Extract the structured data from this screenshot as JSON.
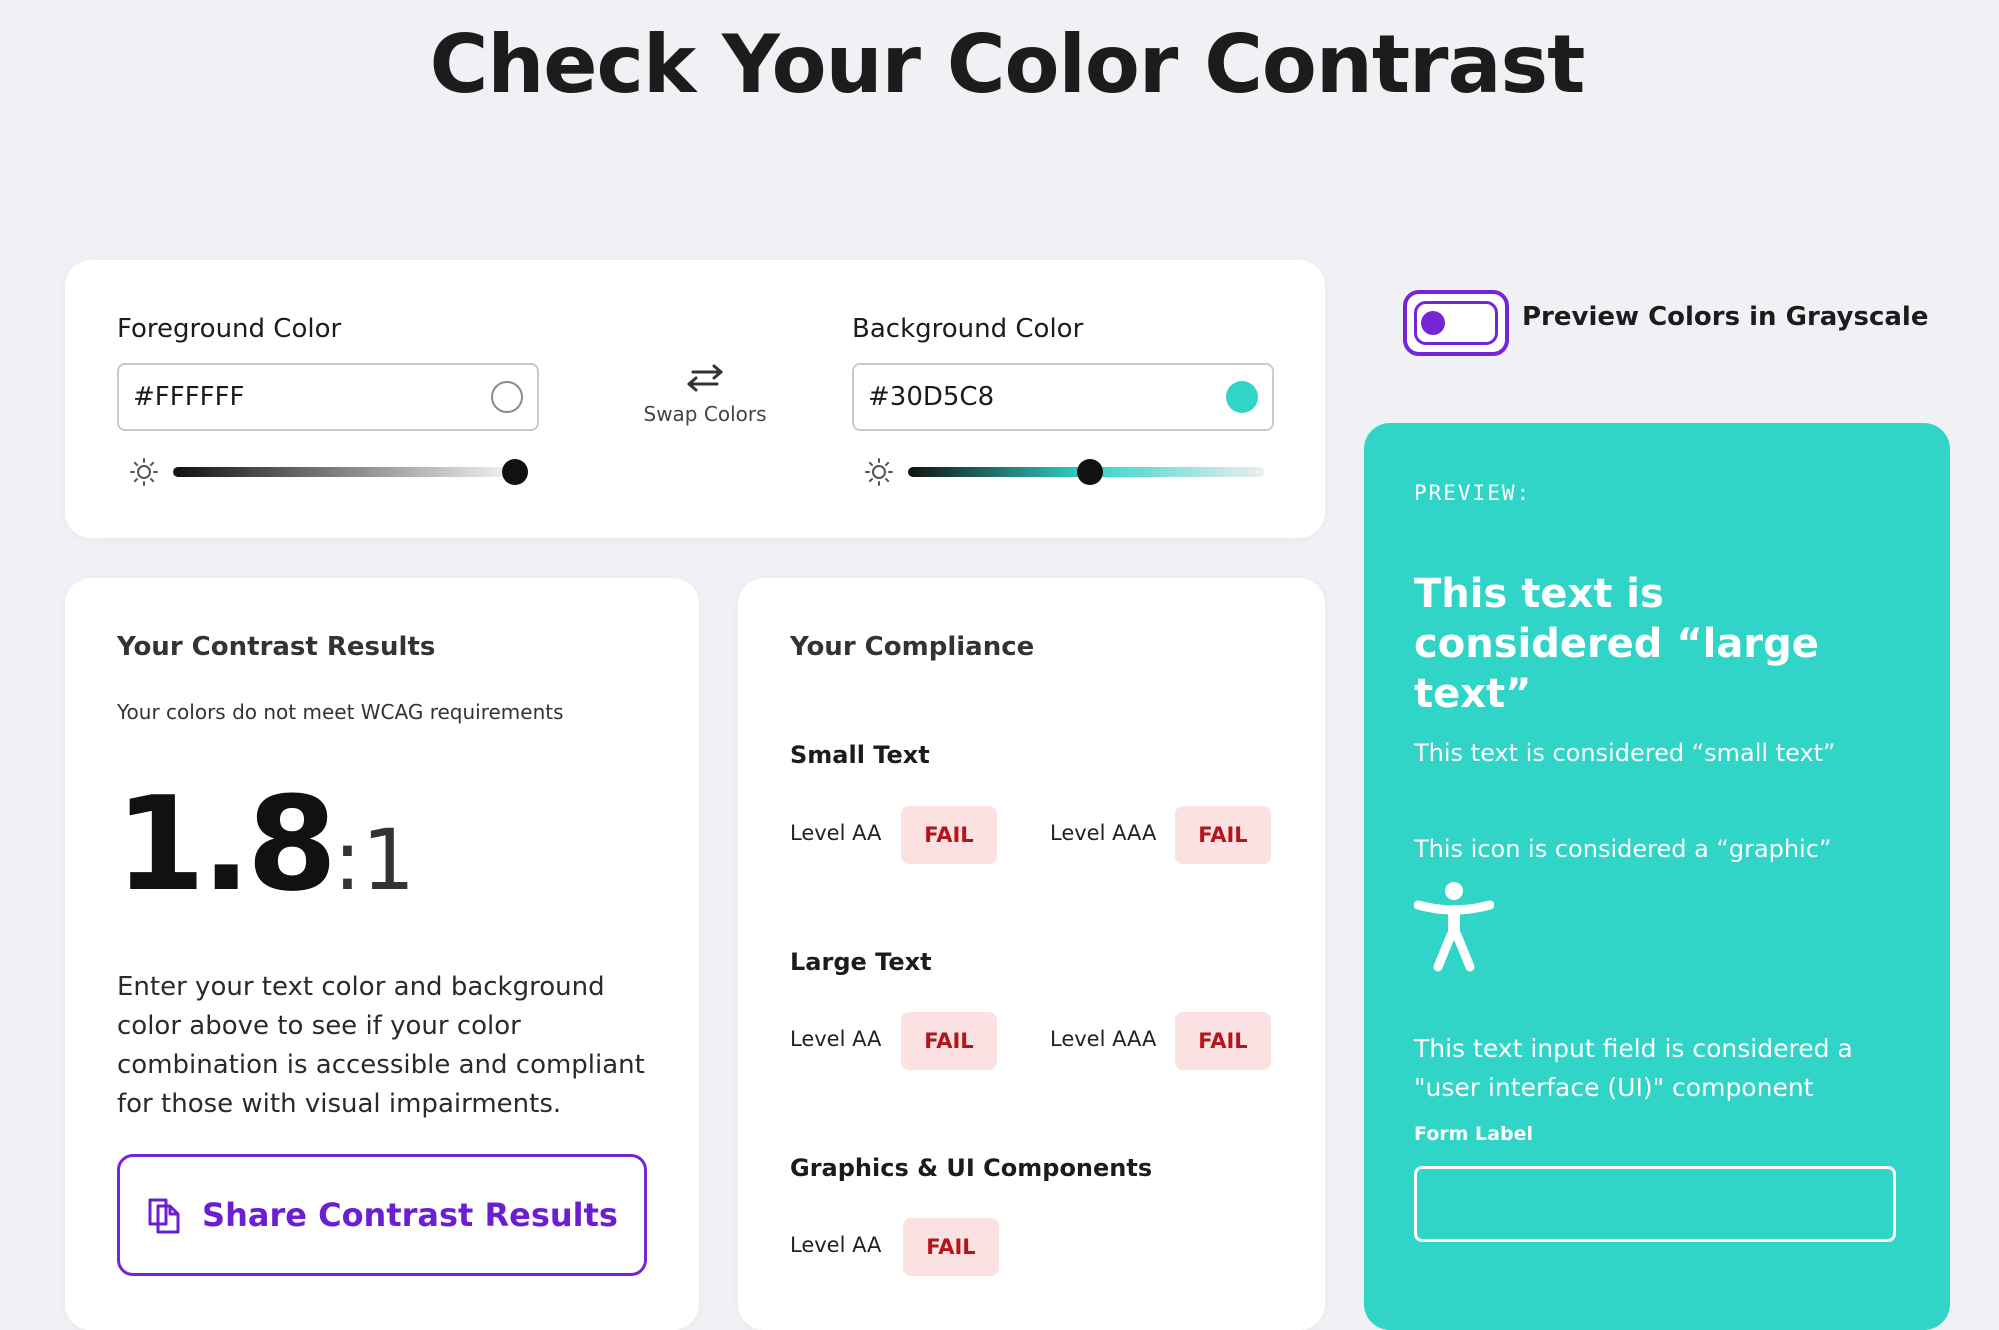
{
  "page": {
    "title": "Check Your Color Contrast"
  },
  "colors": {
    "foreground": {
      "label": "Foreground Color",
      "value": "#FFFFFF",
      "swatch": "#FFFFFF",
      "slider_level": 0.96
    },
    "background": {
      "label": "Background Color",
      "value": "#30D5C8",
      "swatch": "#30D5C8",
      "slider_level": 0.51
    },
    "swap_label": "Swap Colors"
  },
  "results": {
    "title": "Your Contrast Results",
    "status": "Your colors do not meet WCAG requirements",
    "ratio_value": "1.8",
    "ratio_suffix": ":1",
    "description": "Enter your text color and background color above to see if your color combination is accessible and compliant for those with visual impairments.",
    "share_label": "Share Contrast Results"
  },
  "compliance": {
    "title": "Your Compliance",
    "groups": [
      {
        "title": "Small Text",
        "levels": [
          {
            "label": "Level AA",
            "result": "FAIL"
          },
          {
            "label": "Level AAA",
            "result": "FAIL"
          }
        ]
      },
      {
        "title": "Large Text",
        "levels": [
          {
            "label": "Level AA",
            "result": "FAIL"
          },
          {
            "label": "Level AAA",
            "result": "FAIL"
          }
        ]
      },
      {
        "title": "Graphics & UI Components",
        "levels": [
          {
            "label": "Level AA",
            "result": "FAIL"
          }
        ]
      }
    ]
  },
  "grayscale": {
    "label": "Preview Colors in Grayscale",
    "enabled": false
  },
  "preview": {
    "label": "PREVIEW:",
    "large_text": "This text is considered “large text”",
    "small_text": "This text is considered “small text”",
    "graphic_text": "This icon is considered a “graphic”",
    "ui_text": "This text input field is considered a \"user interface (UI)\" component",
    "form_label": "Form Label",
    "icon": "accessibility-person-icon"
  },
  "theme": {
    "accent": "#7524D6",
    "fail_bg": "#FBE1E1",
    "fail_text": "#B3151C",
    "preview_bg": "#30D5C8"
  }
}
